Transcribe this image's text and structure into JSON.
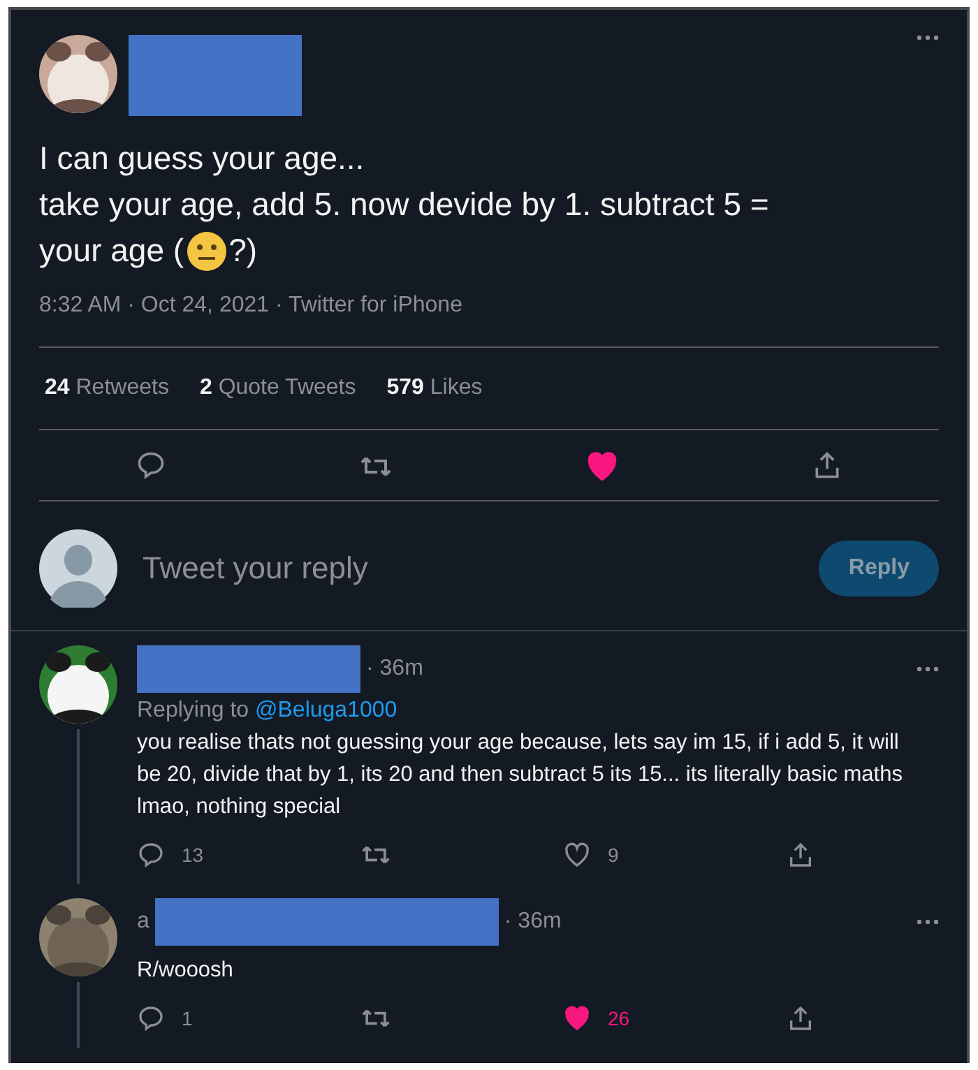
{
  "tweet": {
    "avatar": {
      "kind": "picture"
    },
    "text_lines": [
      "I can guess your age...",
      "take your age, add 5. now devide by 1. subtract 5 ="
    ],
    "text_before_emoji": "your age (",
    "text_after_emoji": "?)",
    "meta": "8:32 AM · Oct 24, 2021 · Twitter for iPhone",
    "stats": [
      {
        "count": "24",
        "label": "Retweets"
      },
      {
        "count": "2",
        "label": "Quote Tweets"
      },
      {
        "count": "579",
        "label": "Likes"
      }
    ],
    "liked": true
  },
  "reply_box": {
    "placeholder": "Tweet your reply",
    "button": "Reply"
  },
  "replies": [
    {
      "avatar": {
        "kind": "picture"
      },
      "time": "· 36m",
      "replying_prefix": "Replying to",
      "replying_handle": "@Beluga1000",
      "text": "you realise thats not guessing your age because, lets say im 15, if i add 5, it will be 20, divide that by 1, its 20 and then subtract 5 its 15... its literally basic maths lmao, nothing special",
      "reply_count": "13",
      "like_count": "9",
      "liked": false
    },
    {
      "avatar": {
        "kind": "picture"
      },
      "name_fragment": "a",
      "time": "· 36m",
      "text": "R/wooosh",
      "reply_count": "1",
      "like_count": "26",
      "liked": true
    }
  ]
}
